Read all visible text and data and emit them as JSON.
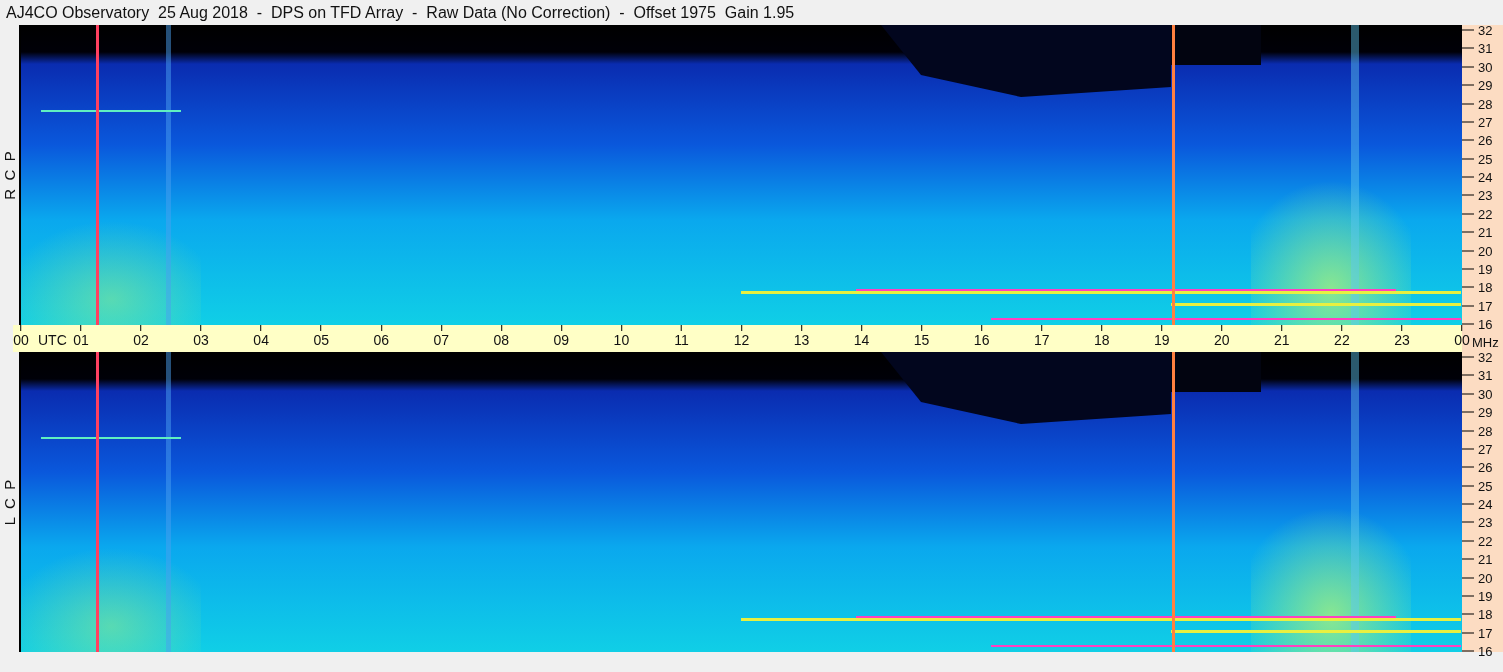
{
  "title": "AJ4CO Observatory  25 Aug 2018  -  DPS on TFD Array  -  Raw Data (No Correction)  -  Offset 1975  Gain 1.95",
  "panels": [
    {
      "label": "R  C  P",
      "freq_ticks": [
        "32",
        "31",
        "30",
        "29",
        "28",
        "27",
        "26",
        "25",
        "24",
        "23",
        "22",
        "21",
        "20",
        "19",
        "18",
        "17",
        "16"
      ]
    },
    {
      "label": "L  C  P",
      "freq_ticks": [
        "32",
        "31",
        "30",
        "29",
        "28",
        "27",
        "26",
        "25",
        "24",
        "23",
        "22",
        "21",
        "20",
        "19",
        "18",
        "17",
        "16"
      ]
    }
  ],
  "time_axis": {
    "ticks": [
      "00",
      "01",
      "02",
      "03",
      "04",
      "05",
      "06",
      "07",
      "08",
      "09",
      "10",
      "11",
      "12",
      "13",
      "14",
      "15",
      "16",
      "17",
      "18",
      "19",
      "20",
      "21",
      "22",
      "23",
      "00"
    ],
    "zone": "UTC",
    "unit": "MHz"
  }
}
